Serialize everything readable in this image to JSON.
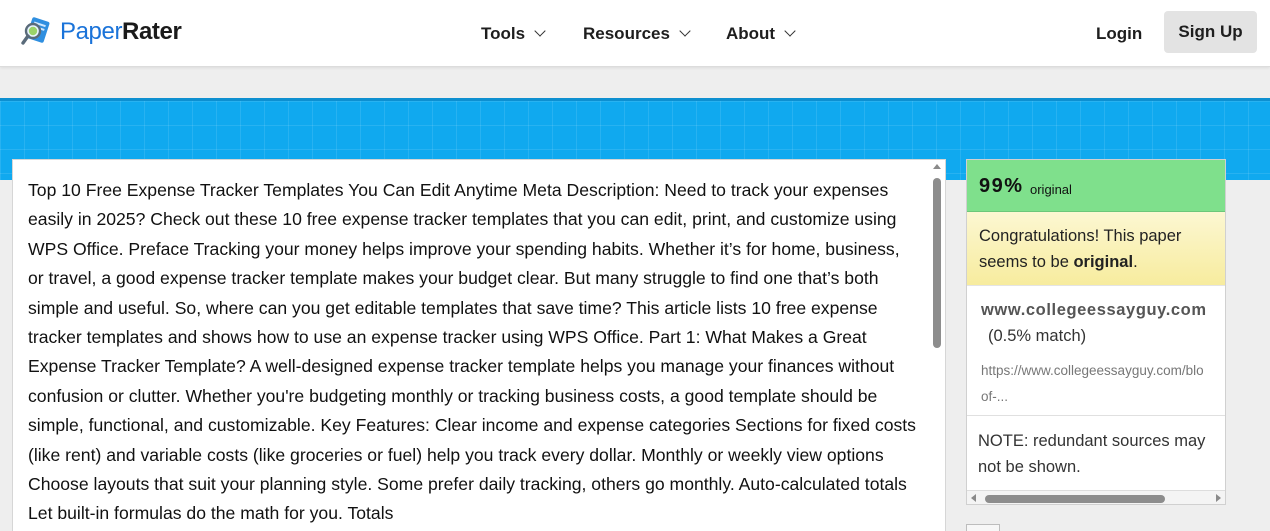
{
  "header": {
    "logo": {
      "part1": "Paper",
      "part2": "Rater",
      "icon": "magnifier-paper-icon"
    },
    "nav": [
      {
        "label": "Tools",
        "icon": "chevron-down-icon"
      },
      {
        "label": "Resources",
        "icon": "chevron-down-icon"
      },
      {
        "label": "About",
        "icon": "chevron-down-icon"
      }
    ],
    "login_label": "Login",
    "signup_label": "Sign Up"
  },
  "colors": {
    "brand_blue": "#1a73d9",
    "band_blue": "#10a9ef",
    "score_green": "#7fe08c",
    "congrats_yellow": "#f7ec9e"
  },
  "document": {
    "text": "Top 10 Free Expense Tracker Templates You Can Edit Anytime Meta Description: Need to track your expenses easily in 2025? Check out these 10 free expense tracker templates that you can edit, print, and customize using WPS Office. Preface Tracking your money helps improve your spending habits. Whether it’s for home, business, or travel, a good expense tracker template makes your budget clear. But many struggle to find one that’s both simple and useful. So, where can you get editable templates that save time? This article lists 10 free expense tracker templates and shows how to use an expense tracker using WPS Office. Part 1: What Makes a Great Expense Tracker Template? A well-designed expense tracker template helps you manage your finances without confusion or clutter. Whether you're budgeting monthly or tracking business costs, a good template should be simple, functional, and customizable. Key Features: Clear income and expense categories Sections for fixed costs (like rent) and variable costs (like groceries or fuel) help you track every dollar. Monthly or weekly view options Choose layouts that suit your planning style. Some prefer daily tracking, others go monthly. Auto-calculated totals Let built-in formulas do the math for you. Totals"
  },
  "results": {
    "score_value": "99%",
    "score_label": "original",
    "congrats_prefix": "Congratulations! This paper seems to be ",
    "congrats_bold": "original",
    "congrats_suffix": ".",
    "source": {
      "domain": "www.collegeessayguy.com",
      "match": "(0.5% match)",
      "url_line1": "https://www.collegeessayguy.com/blo",
      "url_line2": "of-..."
    },
    "note": "NOTE: redundant sources may not be shown."
  }
}
